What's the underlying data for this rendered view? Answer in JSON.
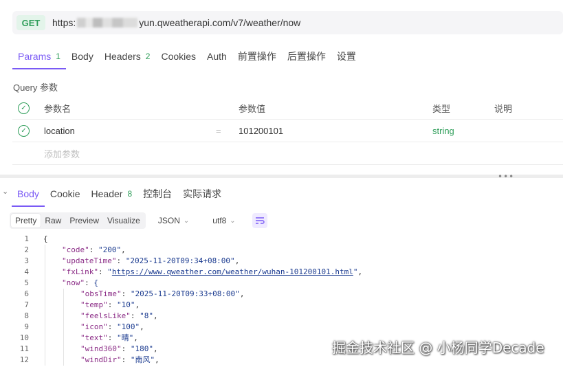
{
  "request": {
    "method": "GET",
    "url_prefix": "https:",
    "url_suffix": "yun.qweatherapi.com/v7/weather/now"
  },
  "request_tabs": [
    {
      "label": "Params",
      "count": "1",
      "active": true
    },
    {
      "label": "Body",
      "count": ""
    },
    {
      "label": "Headers",
      "count": "2"
    },
    {
      "label": "Cookies",
      "count": ""
    },
    {
      "label": "Auth",
      "count": ""
    },
    {
      "label": "前置操作",
      "count": ""
    },
    {
      "label": "后置操作",
      "count": ""
    },
    {
      "label": "设置",
      "count": ""
    }
  ],
  "query_section": "Query 参数",
  "params_table": {
    "headers": {
      "name": "参数名",
      "value": "参数值",
      "type": "类型",
      "desc": "说明"
    },
    "rows": [
      {
        "name": "location",
        "eq": "=",
        "value": "101200101",
        "type": "string"
      }
    ],
    "add_placeholder": "添加参数"
  },
  "splitter_dots": "•••",
  "response_tabs": [
    {
      "label": "Body",
      "count": "",
      "active": true
    },
    {
      "label": "Cookie",
      "count": ""
    },
    {
      "label": "Header",
      "count": "8"
    },
    {
      "label": "控制台",
      "count": ""
    },
    {
      "label": "实际请求",
      "count": ""
    }
  ],
  "view_modes": [
    "Pretty",
    "Raw",
    "Preview",
    "Visualize"
  ],
  "active_view_mode": "Pretty",
  "format_select": "JSON",
  "encoding_select": "utf8",
  "code_lines": [
    {
      "n": "1",
      "indent": 0,
      "text": "{"
    },
    {
      "n": "2",
      "indent": 1,
      "key": "\"code\"",
      "val": "\"200\"",
      "end": ","
    },
    {
      "n": "3",
      "indent": 1,
      "key": "\"updateTime\"",
      "val": "\"2025-11-20T09:34+08:00\"",
      "end": ","
    },
    {
      "n": "4",
      "indent": 1,
      "key": "\"fxLink\"",
      "val": "\"",
      "link": "https://www.qweather.com/weather/wuhan-101200101.html",
      "val2": "\"",
      "end": ","
    },
    {
      "n": "5",
      "indent": 1,
      "key": "\"now\"",
      "val": "{",
      "end": ""
    },
    {
      "n": "6",
      "indent": 2,
      "key": "\"obsTime\"",
      "val": "\"2025-11-20T09:33+08:00\"",
      "end": ","
    },
    {
      "n": "7",
      "indent": 2,
      "key": "\"temp\"",
      "val": "\"10\"",
      "end": ","
    },
    {
      "n": "8",
      "indent": 2,
      "key": "\"feelsLike\"",
      "val": "\"8\"",
      "end": ","
    },
    {
      "n": "9",
      "indent": 2,
      "key": "\"icon\"",
      "val": "\"100\"",
      "end": ","
    },
    {
      "n": "10",
      "indent": 2,
      "key": "\"text\"",
      "val": "\"晴\"",
      "end": ","
    },
    {
      "n": "11",
      "indent": 2,
      "key": "\"wind360\"",
      "val": "\"180\"",
      "end": ","
    },
    {
      "n": "12",
      "indent": 2,
      "key": "\"windDir\"",
      "val": "\"南风\"",
      "end": ","
    }
  ],
  "watermark": "掘金技术社区 @ 小杨同学Decade",
  "colors": {
    "accent": "#7a5af5",
    "green": "#2f9e5a"
  }
}
